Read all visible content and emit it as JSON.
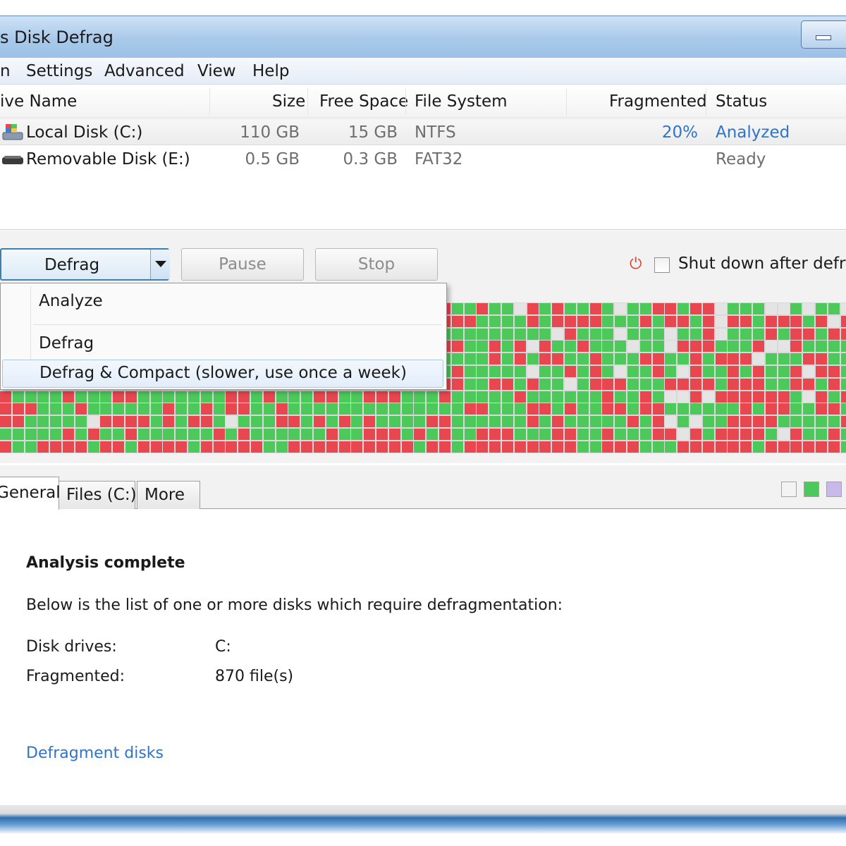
{
  "window": {
    "title": "s Disk Defrag"
  },
  "menu": {
    "items": [
      "n",
      "Settings",
      "Advanced",
      "View",
      "Help"
    ]
  },
  "drive_table": {
    "headers": [
      "ive Name",
      "Size",
      "Free Space",
      "File System",
      "Fragmented",
      "Status"
    ],
    "rows": [
      {
        "name": "Local Disk (C:)",
        "size": "110 GB",
        "free": "15 GB",
        "fs": "NTFS",
        "fragmented": "20%",
        "status": "Analyzed",
        "icon": "local-disk-icon",
        "selected": true
      },
      {
        "name": "Removable Disk (E:)",
        "size": "0.5 GB",
        "free": "0.3 GB",
        "fs": "FAT32",
        "fragmented": "",
        "status": "Ready",
        "icon": "removable-disk-icon",
        "selected": false
      }
    ]
  },
  "toolbar": {
    "defrag_label": "Defrag",
    "pause_label": "Pause",
    "stop_label": "Stop",
    "shutdown_label": "Shut down after defrag",
    "shutdown_checked": false
  },
  "dropdown": {
    "items": [
      "Analyze",
      "Defrag",
      "Defrag & Compact (slower, use once a week)"
    ],
    "highlighted_index": 2
  },
  "tabs": {
    "items": [
      "General",
      "Files (C:)",
      "More"
    ],
    "active_index": 0
  },
  "legend_colors": [
    "#f3f3f3",
    "#4cc95a",
    "#c9b8ea"
  ],
  "cluster_colors": {
    "fragmented": "#e8474f",
    "used": "#4cc95a",
    "free": "#e4e4e4"
  },
  "info": {
    "title": "Analysis complete",
    "description": "Below is the list of one or more disks which require defragmentation:",
    "disk_drives_label": "Disk drives:",
    "disk_drives_value": "C:",
    "fragmented_label": "Fragmented:",
    "fragmented_value": "870 file(s)",
    "link": "Defragment disks"
  }
}
